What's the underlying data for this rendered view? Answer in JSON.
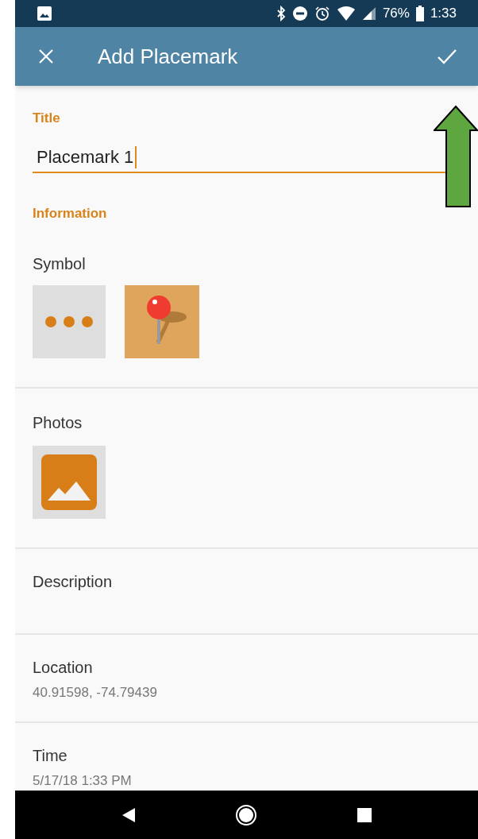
{
  "status_bar": {
    "battery": "76%",
    "time": "1:33"
  },
  "app_bar": {
    "title": "Add Placemark"
  },
  "title_section": {
    "label": "Title",
    "field": {
      "value": "Placemark 1",
      "focused": true
    }
  },
  "information": {
    "heading": "Information"
  },
  "symbol": {
    "label": "Symbol"
  },
  "photos": {
    "label": "Photos"
  },
  "description": {
    "label": "Description"
  },
  "location": {
    "label": "Location",
    "value": "40.91598, -74.79439"
  },
  "time": {
    "label": "Time",
    "value": "5/17/18 1:33 PM"
  }
}
